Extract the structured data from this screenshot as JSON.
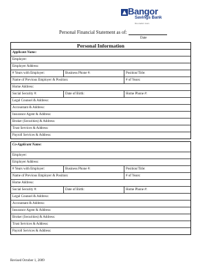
{
  "logo": {
    "brand": "Bangor",
    "bank": "Savings Bank",
    "tagline": "You matter more."
  },
  "statement": {
    "title": "Personal Financial Statement as of:",
    "date_label": "Date"
  },
  "section_title": "Personal Information",
  "applicant": {
    "header": "Applicant Name:",
    "employer": "Employer:",
    "employer_address": "Employer Address:",
    "years_with_employer": "# Years with Employer:",
    "business_phone": "Business Phone #:",
    "position_title": "Position/Title:",
    "prev_employer": "Name of Previous Employer & Position:",
    "years": "# of Years:",
    "home_address": "Home Address:",
    "ssn": "Social Security #:",
    "dob": "Date of Birth:",
    "home_phone": "Home Phone #:",
    "legal_counsel": "Legal Counsel & Address:",
    "accountant": "Accountant & Address:",
    "insurance": "Insurance Agent & Address:",
    "broker": "Broker (Securities) & Address:",
    "trust": "Trust Services & Address:",
    "payroll": "Payroll Services & Address:"
  },
  "coapplicant": {
    "header": "Co-Applicant Name:",
    "employer": "Employer:",
    "employer_address": "Employer Address:",
    "years_with_employer": "# Years with Employer:",
    "business_phone": "Business Phone #:",
    "position_title": "Position/Title:",
    "prev_employer": "Name of Previous Employer & Position:",
    "years": "# of Years:",
    "home_address": "Home Address:",
    "ssn": "Social Security #:",
    "dob": "Date of Birth:",
    "home_phone": "Home Phone #:",
    "legal_counsel": "Legal Counsel & Address:",
    "accountant": "Accountant & Address:",
    "insurance": "Insurance Agent & Address:",
    "broker": "Broker (Securities) & Address:",
    "trust": "Trust Services & Address:",
    "payroll": "Payroll Services & Address:"
  },
  "footer": {
    "revised": "Revised October 1, 2009"
  },
  "colors": {
    "brand": "#1f3f8a"
  }
}
